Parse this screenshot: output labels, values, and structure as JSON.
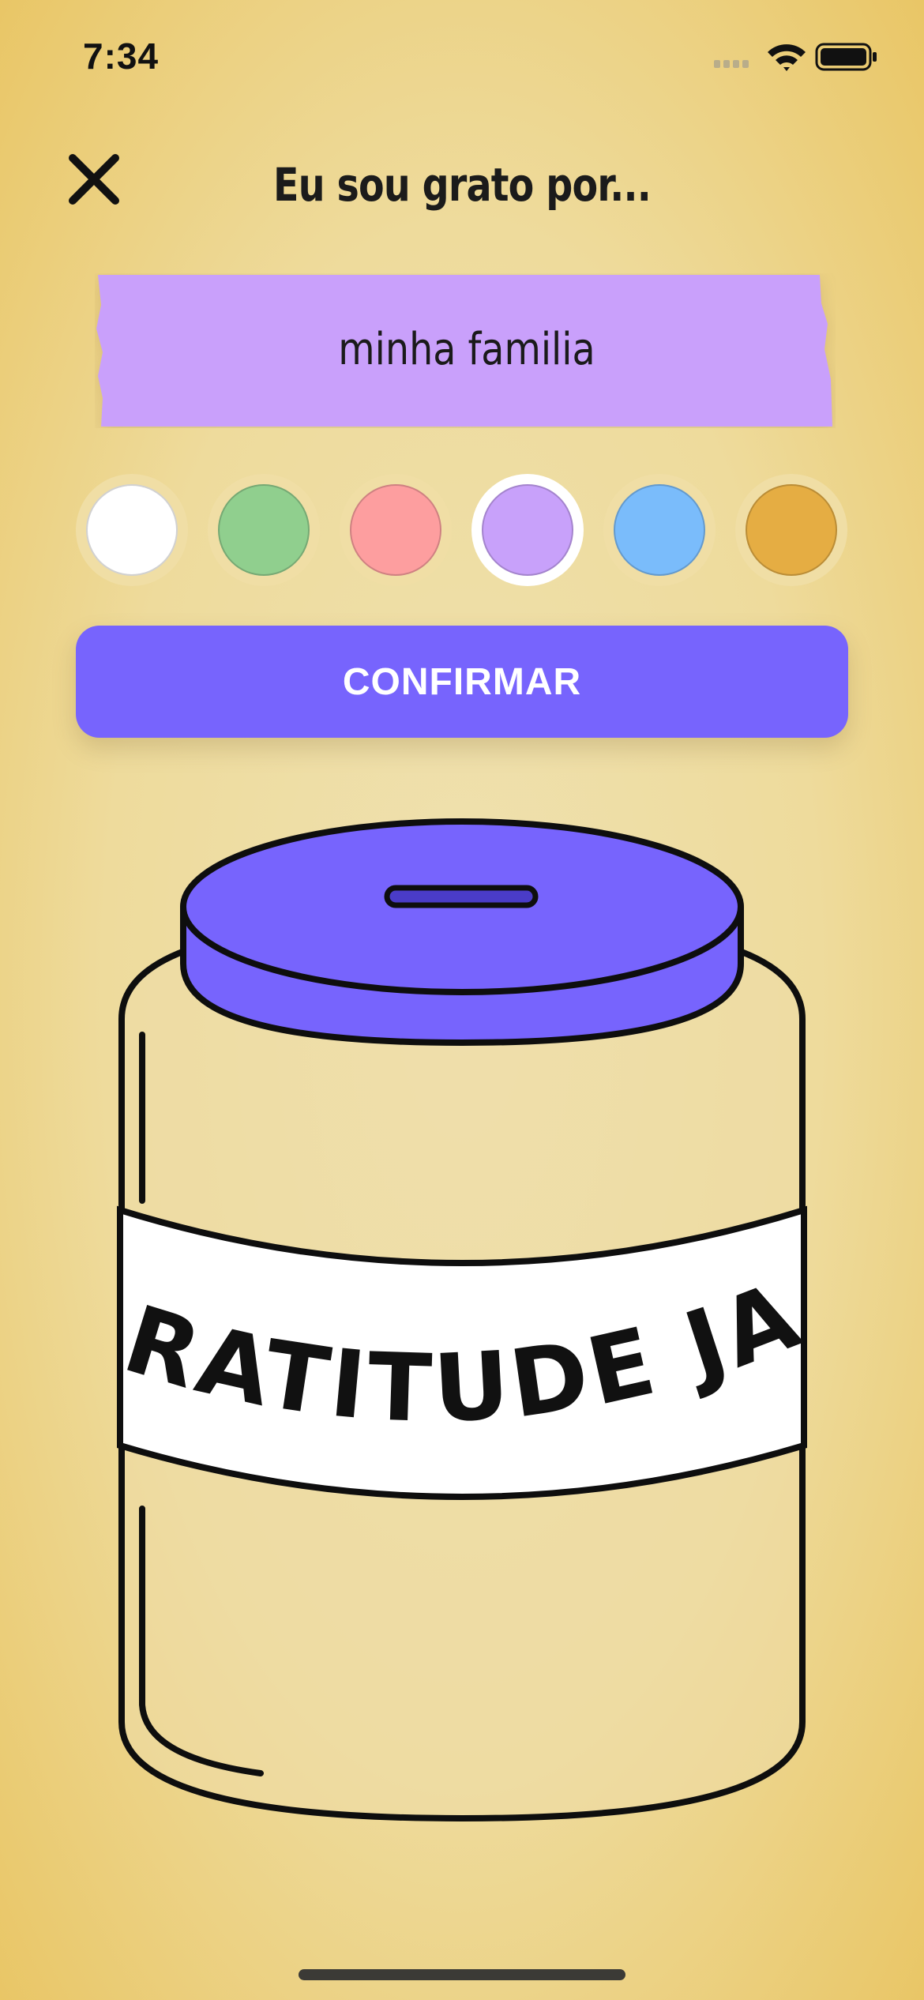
{
  "status_bar": {
    "time": "7:34"
  },
  "header": {
    "title": "Eu sou grato por..."
  },
  "note": {
    "value": "minha familia",
    "color": "#c9a0fb"
  },
  "swatches": [
    {
      "name": "white",
      "color": "#ffffff",
      "selected": false
    },
    {
      "name": "green",
      "color": "#90cf8e",
      "selected": false
    },
    {
      "name": "pink",
      "color": "#fd9e9f",
      "selected": false
    },
    {
      "name": "purple",
      "color": "#c8a1fa",
      "selected": true
    },
    {
      "name": "blue",
      "color": "#7abcfb",
      "selected": false
    },
    {
      "name": "orange",
      "color": "#e5ad43",
      "selected": false
    }
  ],
  "confirm": {
    "label": "CONFIRMAR"
  },
  "jar": {
    "label": "GRATITUDE JAR",
    "lid_color": "#7764fd"
  },
  "colors": {
    "accent": "#7764fd",
    "background": "#eedb9c"
  }
}
